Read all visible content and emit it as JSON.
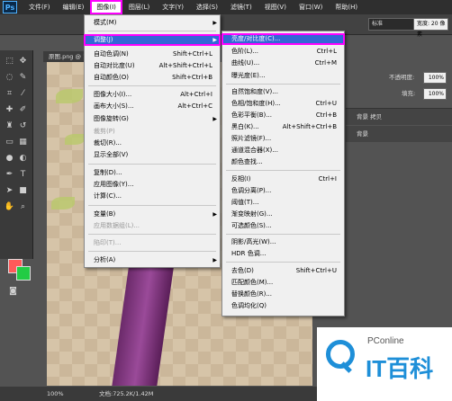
{
  "app": {
    "logo": "Ps"
  },
  "menubar": [
    "文件(F)",
    "编辑(E)",
    "图像(I)",
    "图层(L)",
    "文字(Y)",
    "选择(S)",
    "滤镜(T)",
    "视图(V)",
    "窗口(W)",
    "帮助(H)"
  ],
  "optbar": {
    "mode": "标准",
    "size_label": "宽度: 20 像素",
    "select_label": ""
  },
  "document": {
    "tab": "原图.png @ 100%",
    "zoom": "100%",
    "doc_info": "文档:725.2K/1.42M"
  },
  "panels": {
    "opacity_label": "不透明度:",
    "opacity": "100%",
    "fill_label": "填充:",
    "fill": "100%",
    "layer1": "背景 拷贝",
    "layer2": "背景"
  },
  "colors": {
    "fg": "#ff5a5a",
    "bg": "#22cc44",
    "highlight": "#3367d6",
    "annotation": "#ff00ff"
  },
  "image_menu": {
    "items": [
      {
        "label": "模式(M)",
        "shortcut": "",
        "submenu": true,
        "disabled": false
      },
      {
        "label": "调整(J)",
        "shortcut": "",
        "submenu": true,
        "disabled": false,
        "highlight": true
      },
      {
        "label": "自动色调(N)",
        "shortcut": "Shift+Ctrl+L"
      },
      {
        "label": "自动对比度(U)",
        "shortcut": "Alt+Shift+Ctrl+L"
      },
      {
        "label": "自动颜色(O)",
        "shortcut": "Shift+Ctrl+B"
      },
      {
        "label": "图像大小(I)...",
        "shortcut": "Alt+Ctrl+I"
      },
      {
        "label": "画布大小(S)...",
        "shortcut": "Alt+Ctrl+C"
      },
      {
        "label": "图像旋转(G)",
        "shortcut": "",
        "submenu": true
      },
      {
        "label": "裁剪(P)",
        "shortcut": "",
        "disabled": true
      },
      {
        "label": "裁切(R)...",
        "shortcut": ""
      },
      {
        "label": "显示全部(V)",
        "shortcut": ""
      },
      {
        "label": "复制(D)...",
        "shortcut": ""
      },
      {
        "label": "应用图像(Y)...",
        "shortcut": ""
      },
      {
        "label": "计算(C)...",
        "shortcut": ""
      },
      {
        "label": "变量(B)",
        "shortcut": "",
        "submenu": true
      },
      {
        "label": "应用数据组(L)...",
        "shortcut": "",
        "disabled": true
      },
      {
        "label": "陷印(T)...",
        "shortcut": "",
        "disabled": true
      },
      {
        "label": "分析(A)",
        "shortcut": "",
        "submenu": true
      }
    ]
  },
  "adjust_menu": {
    "items": [
      {
        "label": "亮度/对比度(C)...",
        "shortcut": "",
        "highlight": true
      },
      {
        "label": "色阶(L)...",
        "shortcut": "Ctrl+L"
      },
      {
        "label": "曲线(U)...",
        "shortcut": "Ctrl+M"
      },
      {
        "label": "曝光度(E)...",
        "shortcut": ""
      },
      {
        "label": "自然饱和度(V)...",
        "shortcut": ""
      },
      {
        "label": "色相/饱和度(H)...",
        "shortcut": "Ctrl+U"
      },
      {
        "label": "色彩平衡(B)...",
        "shortcut": "Ctrl+B"
      },
      {
        "label": "黑白(K)...",
        "shortcut": "Alt+Shift+Ctrl+B"
      },
      {
        "label": "照片滤镜(F)...",
        "shortcut": ""
      },
      {
        "label": "通道混合器(X)...",
        "shortcut": ""
      },
      {
        "label": "颜色查找...",
        "shortcut": ""
      },
      {
        "label": "反相(I)",
        "shortcut": "Ctrl+I"
      },
      {
        "label": "色调分离(P)...",
        "shortcut": ""
      },
      {
        "label": "阈值(T)...",
        "shortcut": ""
      },
      {
        "label": "渐变映射(G)...",
        "shortcut": ""
      },
      {
        "label": "可选颜色(S)...",
        "shortcut": ""
      },
      {
        "label": "阴影/高光(W)...",
        "shortcut": ""
      },
      {
        "label": "HDR 色调...",
        "shortcut": ""
      },
      {
        "label": "去色(D)",
        "shortcut": "Shift+Ctrl+U"
      },
      {
        "label": "匹配颜色(M)...",
        "shortcut": ""
      },
      {
        "label": "替换颜色(R)...",
        "shortcut": ""
      },
      {
        "label": "色调均化(Q)",
        "shortcut": ""
      }
    ]
  },
  "watermark": {
    "brand": "PConline",
    "text": "IT百科"
  }
}
